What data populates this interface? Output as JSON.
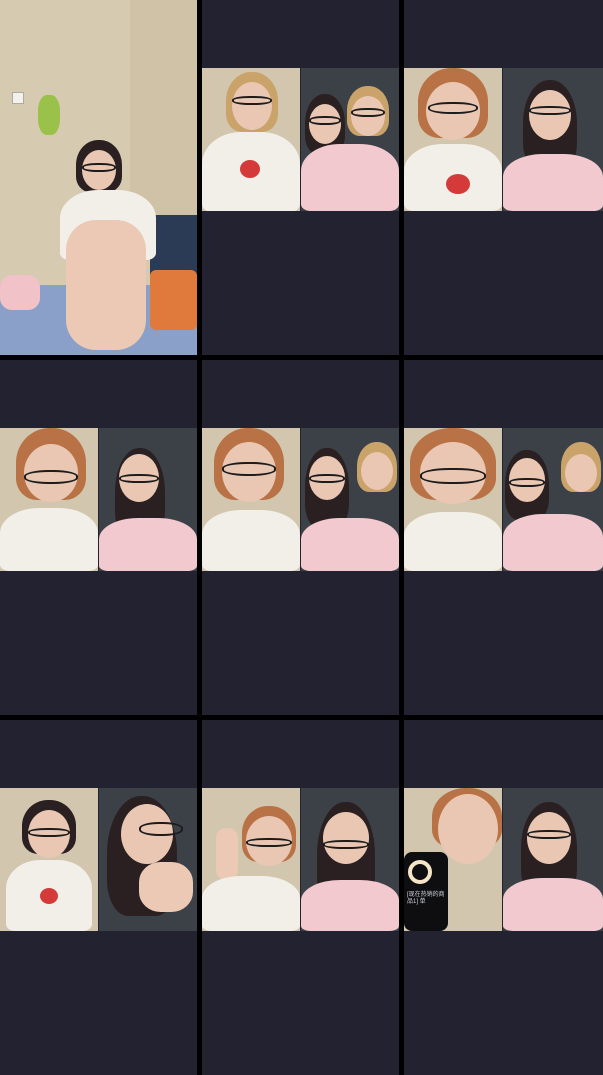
{
  "grid": {
    "background": "#000000",
    "tile_color": "#222230"
  },
  "tiles": [
    {
      "row": 1,
      "col": 1,
      "kind": "room-solo"
    },
    {
      "row": 1,
      "col": 2,
      "kind": "split-three"
    },
    {
      "row": 1,
      "col": 3,
      "kind": "split-two"
    },
    {
      "row": 2,
      "col": 1,
      "kind": "split-two"
    },
    {
      "row": 2,
      "col": 2,
      "kind": "split-three"
    },
    {
      "row": 2,
      "col": 3,
      "kind": "split-three"
    },
    {
      "row": 3,
      "col": 1,
      "kind": "split-two"
    },
    {
      "row": 3,
      "col": 2,
      "kind": "split-two"
    },
    {
      "row": 3,
      "col": 3,
      "kind": "split-two-phone"
    }
  ],
  "phone_overlay": {
    "line1": "[现在热销的商品1] 单",
    "line2": ""
  }
}
